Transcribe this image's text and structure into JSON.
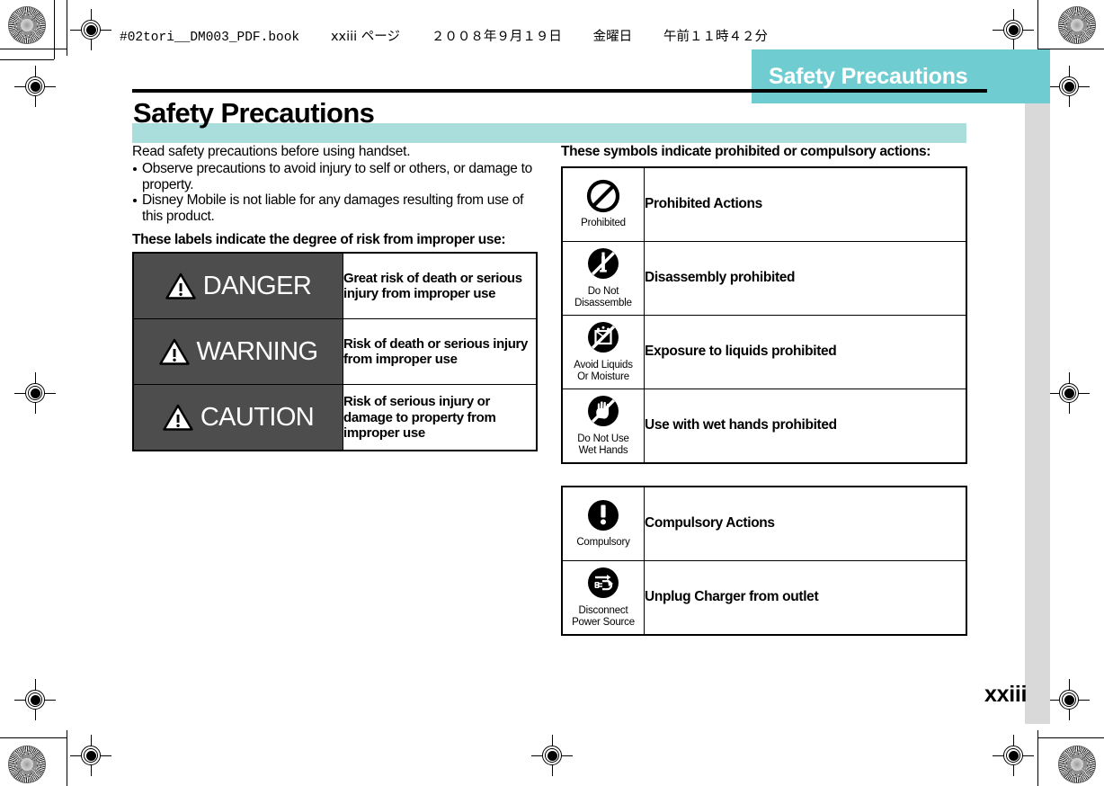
{
  "print_header": {
    "book_file": "#02tori__DM003_PDF.book",
    "page_label": "xxiii ページ",
    "date": "２００８年９月１９日",
    "weekday": "金曜日",
    "time": "午前１１時４２分"
  },
  "chapter_tab": {
    "label": "Safety Precautions",
    "background": "#6fcdd2",
    "text_color": "#ffffff"
  },
  "page": {
    "title": "Safety Precautions",
    "title_highlight_color": "#a9dedd",
    "folio": "xxiii"
  },
  "left_column": {
    "lede": "Read safety precautions before using handset.",
    "bullets": [
      "Observe precautions to avoid injury to self or others, or damage to property.",
      "Disney Mobile is not liable for any damages resulting from use of this product."
    ],
    "subhead": "These labels indicate the degree of risk from improper use:",
    "risk_table": {
      "label_background": "#4d4d4d",
      "label_text_color": "#ffffff",
      "rows": [
        {
          "icon": "warning-triangle-icon",
          "level": "DANGER",
          "description": "Great risk of death or serious injury from improper use"
        },
        {
          "icon": "warning-triangle-icon",
          "level": "WARNING",
          "description": "Risk of death or serious injury from improper use"
        },
        {
          "icon": "warning-triangle-icon",
          "level": "CAUTION",
          "description": "Risk of serious injury or damage to property from improper use"
        }
      ]
    }
  },
  "right_column": {
    "subhead": "These symbols indicate prohibited or compulsory actions:",
    "prohibited_table": {
      "rows": [
        {
          "icon": "prohibited-circle-slash-icon",
          "caption": "Prohibited",
          "description": "Prohibited Actions"
        },
        {
          "icon": "do-not-disassemble-icon",
          "caption": "Do Not\nDisassemble",
          "description": "Disassembly prohibited"
        },
        {
          "icon": "avoid-liquids-icon",
          "caption": "Avoid Liquids\nOr Moisture",
          "description": "Exposure to liquids prohibited"
        },
        {
          "icon": "no-wet-hands-icon",
          "caption": "Do Not Use\nWet Hands",
          "description": "Use with wet hands prohibited"
        }
      ]
    },
    "compulsory_table": {
      "rows": [
        {
          "icon": "compulsory-exclamation-icon",
          "caption": "Compulsory",
          "description": "Compulsory Actions"
        },
        {
          "icon": "disconnect-power-plug-icon",
          "caption": "Disconnect\nPower Source",
          "description": "Unplug Charger from outlet"
        }
      ]
    }
  }
}
